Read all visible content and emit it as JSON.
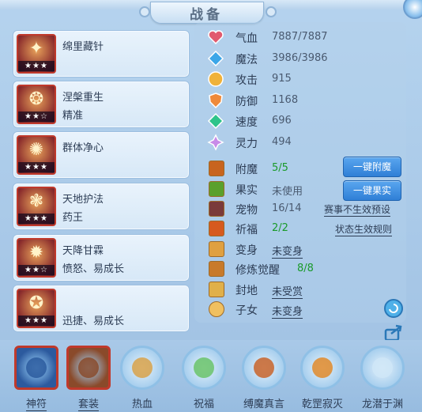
{
  "title": "战备",
  "skills": [
    {
      "name": "绵里藏针",
      "sub": "",
      "stars": "★★★",
      "icon": "ice-needle-icon",
      "glyph": "✦"
    },
    {
      "name": "涅槃重生",
      "sub": "精准",
      "stars": "★★☆",
      "icon": "rebirth-icon",
      "glyph": "❂"
    },
    {
      "name": "群体净心",
      "sub": "",
      "stars": "★★★",
      "icon": "purify-icon",
      "glyph": "✺"
    },
    {
      "name": "天地护法",
      "sub": "药王",
      "stars": "★★★",
      "icon": "guardian-icon",
      "glyph": "❃"
    },
    {
      "name": "天降甘霖",
      "sub": "愤怒、易成长",
      "stars": "★★☆",
      "icon": "rain-icon",
      "glyph": "✹"
    },
    {
      "name": "",
      "sub": "迅捷、易成长",
      "stars": "★★★",
      "icon": "warrior-icon",
      "glyph": "✪"
    }
  ],
  "stats": [
    {
      "label": "气血",
      "value": "7887/7887",
      "icon": "heart-icon",
      "color": "#e15a6e"
    },
    {
      "label": "魔法",
      "value": "3986/3986",
      "icon": "mana-icon",
      "color": "#3ba6e8"
    },
    {
      "label": "攻击",
      "value": "915",
      "icon": "attack-icon",
      "color": "#f0b23a"
    },
    {
      "label": "防御",
      "value": "1168",
      "icon": "defense-icon",
      "color": "#ef8a3a"
    },
    {
      "label": "速度",
      "value": "696",
      "icon": "speed-icon",
      "color": "#2ec48a"
    },
    {
      "label": "灵力",
      "value": "494",
      "icon": "spirit-icon",
      "color": "#c88be8"
    }
  ],
  "lines": [
    {
      "label": "附魔",
      "value": "5/5",
      "style": "green",
      "icon": "enchant-icon"
    },
    {
      "label": "果实",
      "value": "未使用",
      "style": "plain",
      "icon": "fruit-icon"
    },
    {
      "label": "宠物",
      "value": "16/14",
      "style": "plain",
      "icon": "pet-icon"
    },
    {
      "label": "祈福",
      "value": "2/2",
      "style": "green",
      "icon": "blessing-icon"
    },
    {
      "label": "变身",
      "value": "未变身",
      "style": "uline",
      "icon": "transform-icon"
    },
    {
      "label": "修炼觉醒",
      "value": "8/8",
      "style": "green",
      "icon": "cultivation-icon"
    },
    {
      "label": "封地",
      "value": "未受赏",
      "style": "uline",
      "icon": "fief-icon"
    },
    {
      "label": "子女",
      "value": "未变身",
      "style": "uline",
      "icon": "child-icon"
    }
  ],
  "buttons": {
    "enchant": "一键附魔",
    "fruit": "一键果实"
  },
  "links": {
    "pet_preset": "赛事不生效预设",
    "status_rule": "状态生效规则"
  },
  "bottom": [
    {
      "label": "神符",
      "icon": "talisman-icon",
      "shape": "square",
      "underline": true
    },
    {
      "label": "套装",
      "icon": "armor-set-icon",
      "shape": "square",
      "underline": true
    },
    {
      "label": "热血",
      "icon": "passion-icon",
      "shape": "round",
      "underline": false
    },
    {
      "label": "祝福",
      "icon": "blessing-leaf-icon",
      "shape": "round",
      "underline": false
    },
    {
      "label": "缚魔真言",
      "icon": "demon-seal-icon",
      "shape": "round",
      "underline": false
    },
    {
      "label": "乾罡寂灭",
      "icon": "annihilation-icon",
      "shape": "round",
      "underline": false
    },
    {
      "label": "龙潜于渊",
      "icon": "dragon-icon",
      "shape": "round",
      "underline": false
    }
  ],
  "colors": {
    "accent": "#2f7fd6",
    "card_border": "#c0392b",
    "value_green": "#1a9a2a"
  }
}
